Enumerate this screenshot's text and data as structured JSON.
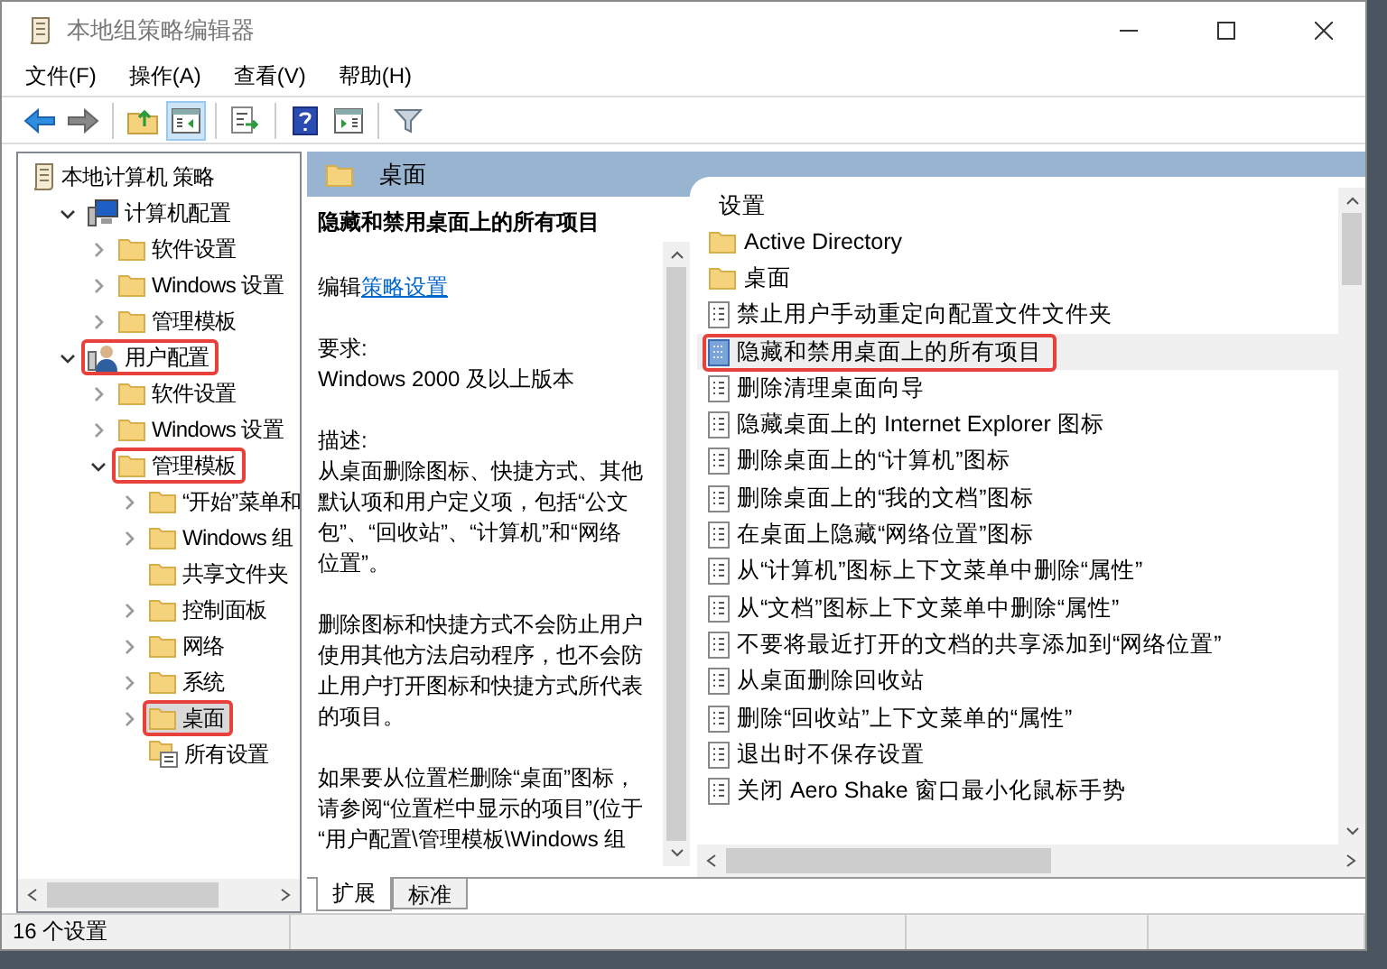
{
  "window": {
    "title": "本地组策略编辑器"
  },
  "menu": [
    "文件(F)",
    "操作(A)",
    "查看(V)",
    "帮助(H)"
  ],
  "toolbar": [
    {
      "kind": "back",
      "pressed": false
    },
    {
      "kind": "forward",
      "pressed": false
    },
    {
      "kind": "sep"
    },
    {
      "kind": "up",
      "pressed": false
    },
    {
      "kind": "tree",
      "pressed": true
    },
    {
      "kind": "sep"
    },
    {
      "kind": "export",
      "pressed": false
    },
    {
      "kind": "sep"
    },
    {
      "kind": "help",
      "pressed": false
    },
    {
      "kind": "view",
      "pressed": false
    },
    {
      "kind": "sep"
    },
    {
      "kind": "filter",
      "pressed": false
    }
  ],
  "tree": [
    {
      "label": "本地计算机 策略",
      "kind": "scroll",
      "selected": false,
      "highlighted": false,
      "children": [
        {
          "label": "计算机配置",
          "kind": "computer",
          "expanded": true,
          "selected": false,
          "highlighted": false,
          "children": [
            {
              "label": "软件设置",
              "kind": "folder",
              "expanded": false,
              "selected": false,
              "highlighted": false
            },
            {
              "label": "Windows 设置",
              "kind": "folder",
              "expanded": false,
              "selected": false,
              "highlighted": false
            },
            {
              "label": "管理模板",
              "kind": "folder",
              "expanded": false,
              "selected": false,
              "highlighted": false
            }
          ]
        },
        {
          "label": "用户配置",
          "kind": "user",
          "expanded": true,
          "selected": false,
          "highlighted": true,
          "children": [
            {
              "label": "软件设置",
              "kind": "folder",
              "expanded": false,
              "selected": false,
              "highlighted": false
            },
            {
              "label": "Windows 设置",
              "kind": "folder",
              "expanded": false,
              "selected": false,
              "highlighted": false
            },
            {
              "label": "管理模板",
              "kind": "folder",
              "expanded": true,
              "selected": false,
              "highlighted": true,
              "children": [
                {
                  "label": "“开始”菜单和",
                  "kind": "folder",
                  "expanded": false,
                  "selected": false,
                  "highlighted": false
                },
                {
                  "label": "Windows 组",
                  "kind": "folder",
                  "expanded": false,
                  "selected": false,
                  "highlighted": false
                },
                {
                  "label": "共享文件夹",
                  "kind": "folder",
                  "selected": false,
                  "highlighted": false
                },
                {
                  "label": "控制面板",
                  "kind": "folder",
                  "expanded": false,
                  "selected": false,
                  "highlighted": false
                },
                {
                  "label": "网络",
                  "kind": "folder",
                  "expanded": false,
                  "selected": false,
                  "highlighted": false
                },
                {
                  "label": "系统",
                  "kind": "folder",
                  "expanded": false,
                  "selected": false,
                  "highlighted": false
                },
                {
                  "label": "桌面",
                  "kind": "folder",
                  "expanded": false,
                  "selected": true,
                  "highlighted": true
                },
                {
                  "label": "所有设置",
                  "kind": "all-settings",
                  "selected": false,
                  "highlighted": false
                }
              ]
            }
          ]
        }
      ]
    }
  ],
  "header": {
    "title": "桌面"
  },
  "description": {
    "title": "隐藏和禁用桌面上的所有项目",
    "edit_prefix": "编辑",
    "edit_link": "策略设置",
    "paragraphs": [
      [
        "要求:",
        "Windows 2000 及以上版本"
      ],
      [
        "描述:",
        "从桌面删除图标、快捷方式、其他",
        "默认项和用户定义项，包括“公文",
        "包”、“回收站”、“计算机”和“网络",
        "位置”。"
      ],
      [
        "删除图标和快捷方式不会防止用户",
        "使用其他方法启动程序，也不会防",
        "止用户打开图标和快捷方式所代表",
        "的项目。"
      ],
      [
        "如果要从位置栏删除“桌面”图标，",
        "请参阅“位置栏中显示的项目”(位于",
        "“用户配置\\管理模板\\Windows 组"
      ]
    ]
  },
  "list": {
    "column": "设置",
    "items": [
      {
        "kind": "folder",
        "label": "Active Directory",
        "selected": false,
        "highlighted": false
      },
      {
        "kind": "folder",
        "label": "桌面",
        "selected": false,
        "highlighted": false
      },
      {
        "kind": "setting",
        "label": "禁止用户手动重定向配置文件文件夹",
        "selected": false,
        "highlighted": false
      },
      {
        "kind": "setting",
        "label": "隐藏和禁用桌面上的所有项目",
        "selected": true,
        "highlighted": true
      },
      {
        "kind": "setting",
        "label": "删除清理桌面向导",
        "selected": false,
        "highlighted": false
      },
      {
        "kind": "setting",
        "label": "隐藏桌面上的 Internet Explorer 图标",
        "selected": false,
        "highlighted": false
      },
      {
        "kind": "setting",
        "label": "删除桌面上的“计算机”图标",
        "selected": false,
        "highlighted": false
      },
      {
        "kind": "setting",
        "label": "删除桌面上的“我的文档”图标",
        "selected": false,
        "highlighted": false
      },
      {
        "kind": "setting",
        "label": "在桌面上隐藏“网络位置”图标",
        "selected": false,
        "highlighted": false
      },
      {
        "kind": "setting",
        "label": "从“计算机”图标上下文菜单中删除“属性”",
        "selected": false,
        "highlighted": false
      },
      {
        "kind": "setting",
        "label": "从“文档”图标上下文菜单中删除“属性”",
        "selected": false,
        "highlighted": false
      },
      {
        "kind": "setting",
        "label": "不要将最近打开的文档的共享添加到“网络位置”",
        "selected": false,
        "highlighted": false
      },
      {
        "kind": "setting",
        "label": "从桌面删除回收站",
        "selected": false,
        "highlighted": false
      },
      {
        "kind": "setting",
        "label": "删除“回收站”上下文菜单的“属性”",
        "selected": false,
        "highlighted": false
      },
      {
        "kind": "setting",
        "label": "退出时不保存设置",
        "selected": false,
        "highlighted": false
      },
      {
        "kind": "setting",
        "label": "关闭 Aero Shake 窗口最小化鼠标手势",
        "selected": false,
        "highlighted": false
      }
    ]
  },
  "tabs": [
    {
      "label": "扩展",
      "selected": true
    },
    {
      "label": "标准",
      "selected": false
    }
  ],
  "status_bar": "16 个设置"
}
